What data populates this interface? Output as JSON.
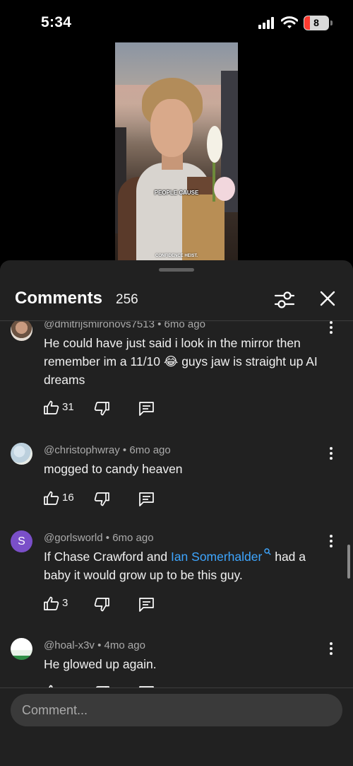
{
  "status_bar": {
    "time": "5:34",
    "battery": "8"
  },
  "video": {
    "caption": "PEOPLE CAUSE",
    "caption_bottom": "CONFIDENCE HEIST."
  },
  "comments_sheet": {
    "title": "Comments",
    "count": "256",
    "input_placeholder": "Comment...",
    "comments": [
      {
        "handle": "@dmitrijsmironovs7513",
        "age": "6mo ago",
        "text": "He could have just said i look in the mirror then remember im a 11/10 😂 guys jaw is straight up AI dreams",
        "likes": "31"
      },
      {
        "handle": "@christophwray",
        "age": "6mo ago",
        "text": "mogged to candy heaven",
        "likes": "16"
      },
      {
        "handle": "@gorlsworld",
        "age": "6mo ago",
        "avatar_letter": "S",
        "text_before": "If Chase Crawford and ",
        "text_link": "Ian Somerhalder",
        "text_after": " had a baby it would grow up to be this guy.",
        "likes": "3"
      },
      {
        "handle": "@hoal-x3v",
        "age": "4mo ago",
        "text": "He glowed up again.",
        "likes": ""
      }
    ]
  },
  "colors": {
    "background": "#000000",
    "sheet": "#212121",
    "link": "#3ea6ff",
    "muted_text": "#aaaaaa",
    "avatar_purple": "#7a4fc8"
  }
}
